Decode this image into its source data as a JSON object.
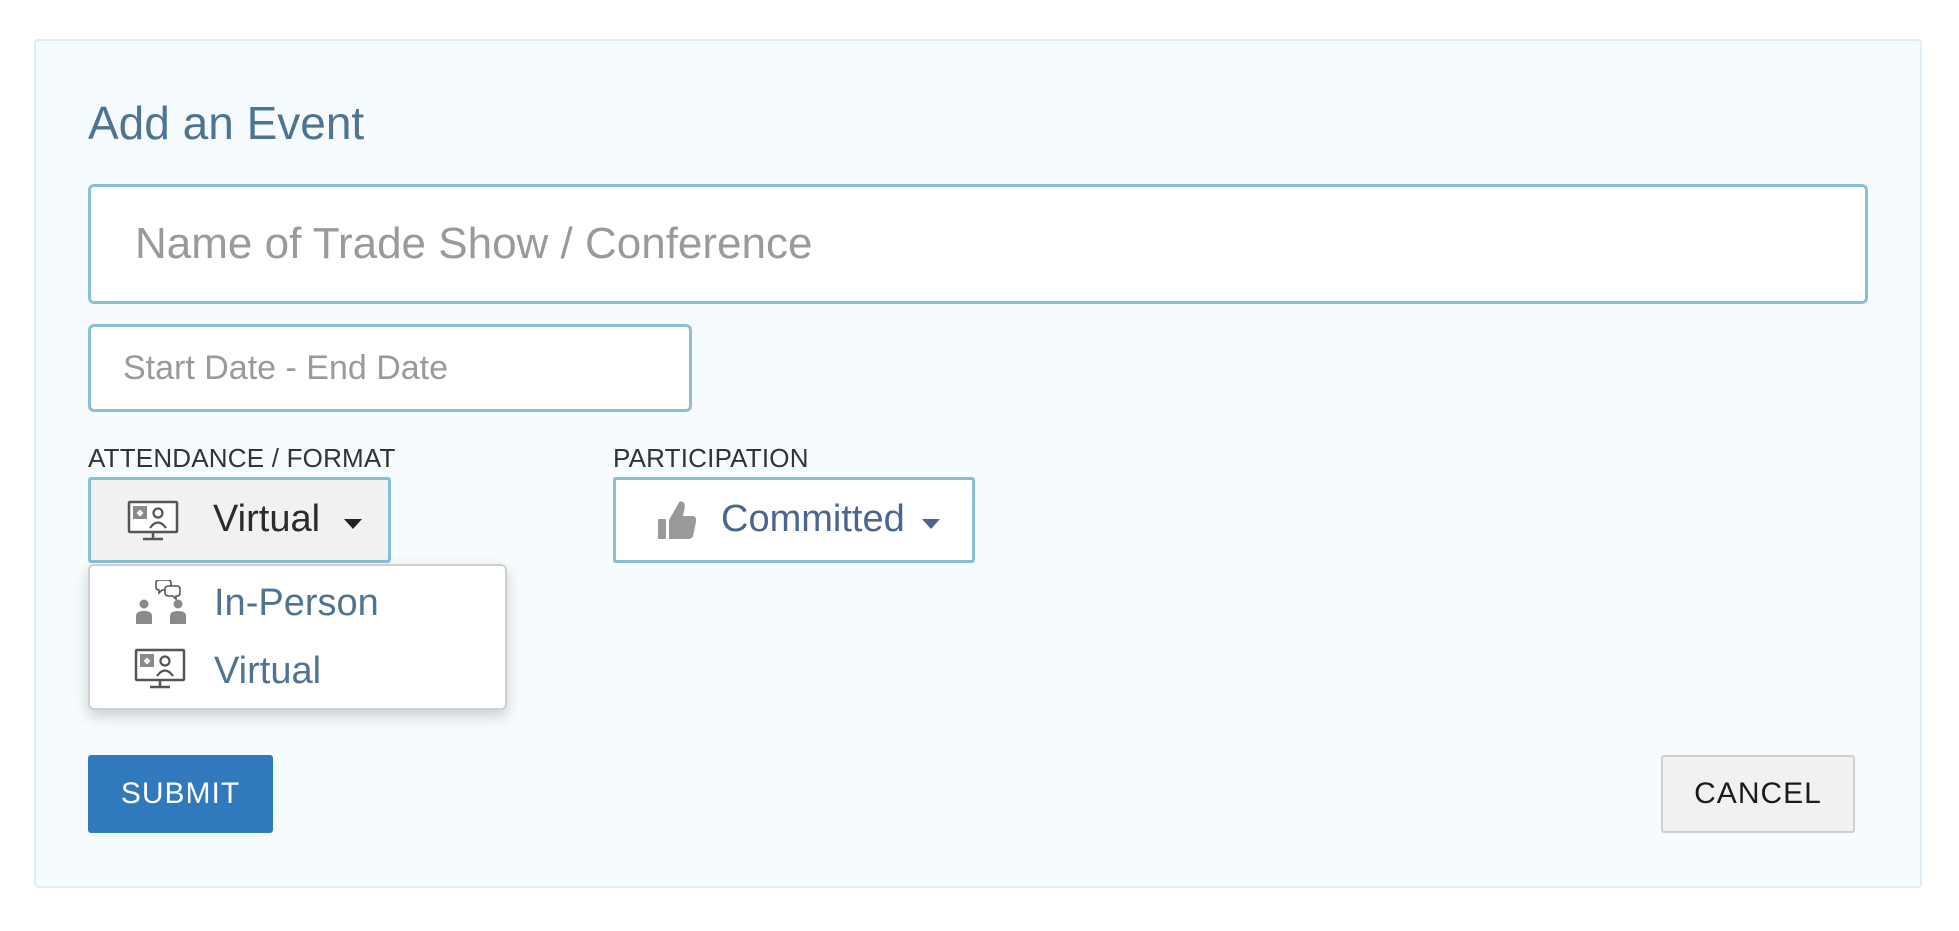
{
  "form": {
    "title": "Add an Event",
    "name_placeholder": "Name of Trade Show / Conference",
    "name_value": "",
    "dates_placeholder": "Start Date - End Date",
    "dates_value": ""
  },
  "attendance": {
    "label": "ATTENDANCE / FORMAT",
    "selected": "Virtual",
    "selected_icon": "virtual-monitor-icon",
    "options": [
      {
        "label": "In-Person",
        "icon": "in-person-people-icon"
      },
      {
        "label": "Virtual",
        "icon": "virtual-monitor-icon"
      }
    ]
  },
  "participation": {
    "label": "PARTICIPATION",
    "selected": "Committed",
    "selected_icon": "thumbs-up-icon"
  },
  "actions": {
    "submit_label": "SUBMIT",
    "cancel_label": "CANCEL"
  },
  "colors": {
    "title": "#4f7493",
    "accent_border": "#8bbfd6",
    "submit_bg": "#3179bd",
    "panel_bg": "#f6fbfe",
    "link_text": "#4f7493"
  }
}
